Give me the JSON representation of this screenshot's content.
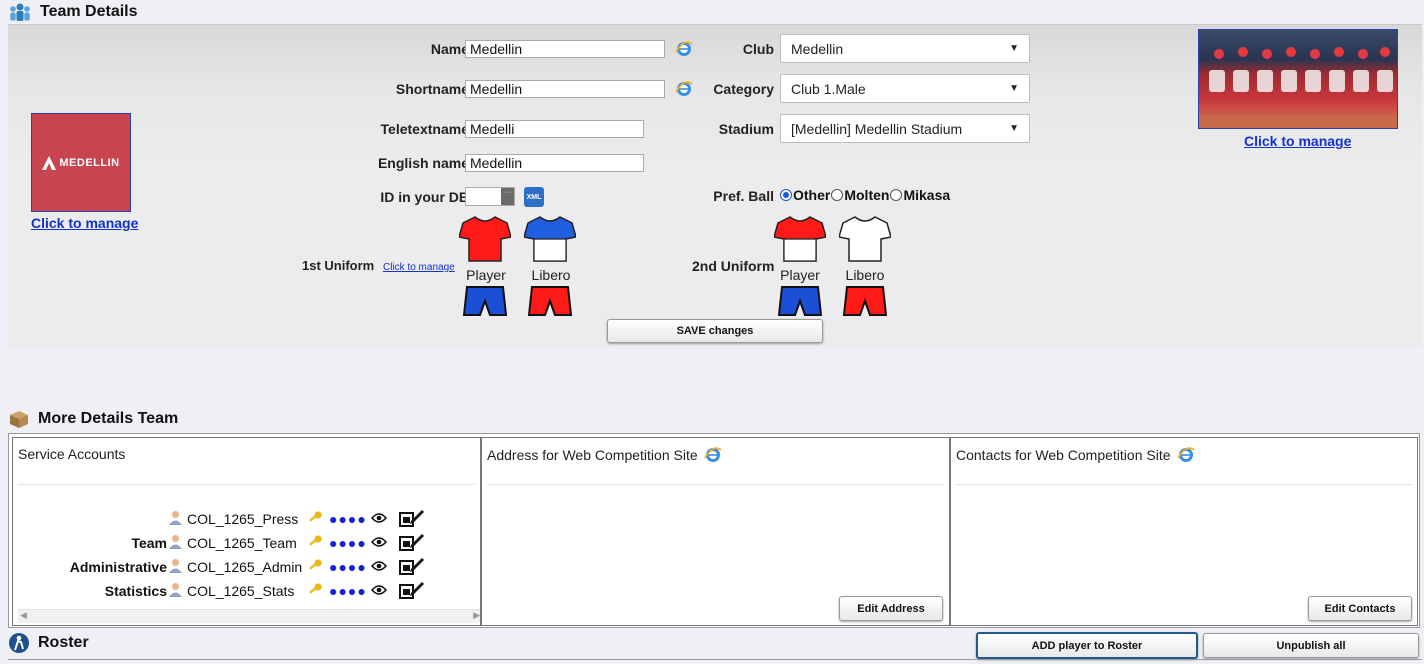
{
  "team_details": {
    "title": "Team Details",
    "name_label": "Name",
    "name_value": "Medellin",
    "shortname_label": "Shortname",
    "shortname_value": "Medellin",
    "teletext_label": "Teletextname",
    "teletext_value": "Medelli",
    "english_label": "English name",
    "english_value": "Medellin",
    "id_label": "ID in your DB",
    "id_value": "",
    "xml_label": "XML",
    "club_label": "Club",
    "club_value": "Medellin",
    "category_label": "Category",
    "category_value": "Club 1.Male",
    "stadium_label": "Stadium",
    "stadium_value": "[Medellin] Medellin Stadium",
    "pref_ball_label": "Pref. Ball",
    "ball_options": [
      "Other",
      "Molten",
      "Mikasa"
    ],
    "ball_selected": "Other",
    "logo_text": "MEDELLIN",
    "logo_link": "Click to manage",
    "photo_link": "Click to manage",
    "uniform1_label": "1st Uniform",
    "uniform1_link": "Click to manage",
    "uniform2_label": "2nd Uniform",
    "player_label": "Player",
    "libero_label": "Libero",
    "save_button": "SAVE changes",
    "colors": {
      "u1_player_shirt": "#ff1a1a",
      "u1_libero_shirt": "#1f5fe0",
      "u1_player_shorts": "#1a4fd6",
      "u1_libero_shorts": "#ff1a1a",
      "u2_player_shirt": "#ff1a1a",
      "u2_libero_shirt": "#ffffff",
      "u2_player_shorts": "#1a4fd6",
      "u2_libero_shorts": "#ff1a1a",
      "logo_bg": "#c8444f",
      "link": "#1133cc"
    }
  },
  "more_details": {
    "title": "More Details Team",
    "service_title": "Service Accounts",
    "accounts": [
      {
        "label": "",
        "username": "COL_1265_Press",
        "password_mask": "●●●●"
      },
      {
        "label": "Team",
        "username": "COL_1265_Team",
        "password_mask": "●●●●"
      },
      {
        "label": "Administrative",
        "username": "COL_1265_Admin",
        "password_mask": "●●●●"
      },
      {
        "label": "Statistics",
        "username": "COL_1265_Stats",
        "password_mask": "●●●●"
      }
    ],
    "address_title": "Address for Web Competition Site",
    "edit_address_button": "Edit Address",
    "contacts_title": "Contacts for Web Competition Site",
    "edit_contacts_button": "Edit Contacts"
  },
  "roster": {
    "title": "Roster",
    "add_button": "ADD player to Roster",
    "unpublish_button": "Unpublish all"
  }
}
